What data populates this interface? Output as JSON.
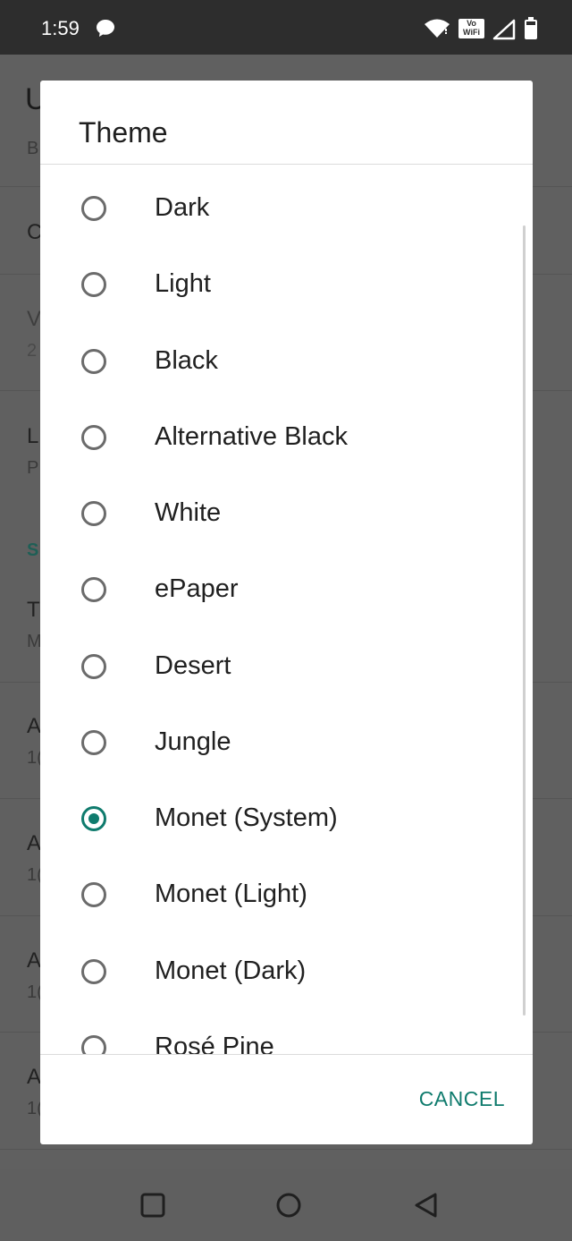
{
  "status_bar": {
    "time": "1:59",
    "vowifi_top": "Vo",
    "vowifi_bottom": "WiFi",
    "icons": [
      "chat-bubble-icon",
      "wifi-icon",
      "vowifi-icon",
      "signal-icon",
      "battery-icon"
    ]
  },
  "background": {
    "title_partial": "U",
    "rows": [
      {
        "text": "B"
      },
      {
        "text": "C"
      },
      {
        "text": "V",
        "sub": "2"
      },
      {
        "text": "L",
        "sub": "P"
      },
      {
        "section": "S"
      },
      {
        "text": "T",
        "sub": "M"
      },
      {
        "text": "A",
        "sub": "1("
      },
      {
        "text": "A",
        "sub": "1("
      },
      {
        "text": "A",
        "sub": "1("
      },
      {
        "text": "A",
        "sub": "1("
      }
    ]
  },
  "dialog": {
    "title": "Theme",
    "options": [
      {
        "label": "Dark",
        "selected": false
      },
      {
        "label": "Light",
        "selected": false
      },
      {
        "label": "Black",
        "selected": false
      },
      {
        "label": "Alternative Black",
        "selected": false
      },
      {
        "label": "White",
        "selected": false
      },
      {
        "label": "ePaper",
        "selected": false
      },
      {
        "label": "Desert",
        "selected": false
      },
      {
        "label": "Jungle",
        "selected": false
      },
      {
        "label": "Monet (System)",
        "selected": true
      },
      {
        "label": "Monet (Light)",
        "selected": false
      },
      {
        "label": "Monet (Dark)",
        "selected": false
      },
      {
        "label": "Rosé Pine",
        "selected": false
      }
    ],
    "cancel_label": "CANCEL"
  },
  "colors": {
    "accent": "#0f7b6d",
    "scrim": "#5f5f5f",
    "status_bar": "#2d2d2d"
  },
  "nav_bar": {
    "icons": [
      "recents-square-icon",
      "home-circle-icon",
      "back-triangle-icon"
    ]
  }
}
